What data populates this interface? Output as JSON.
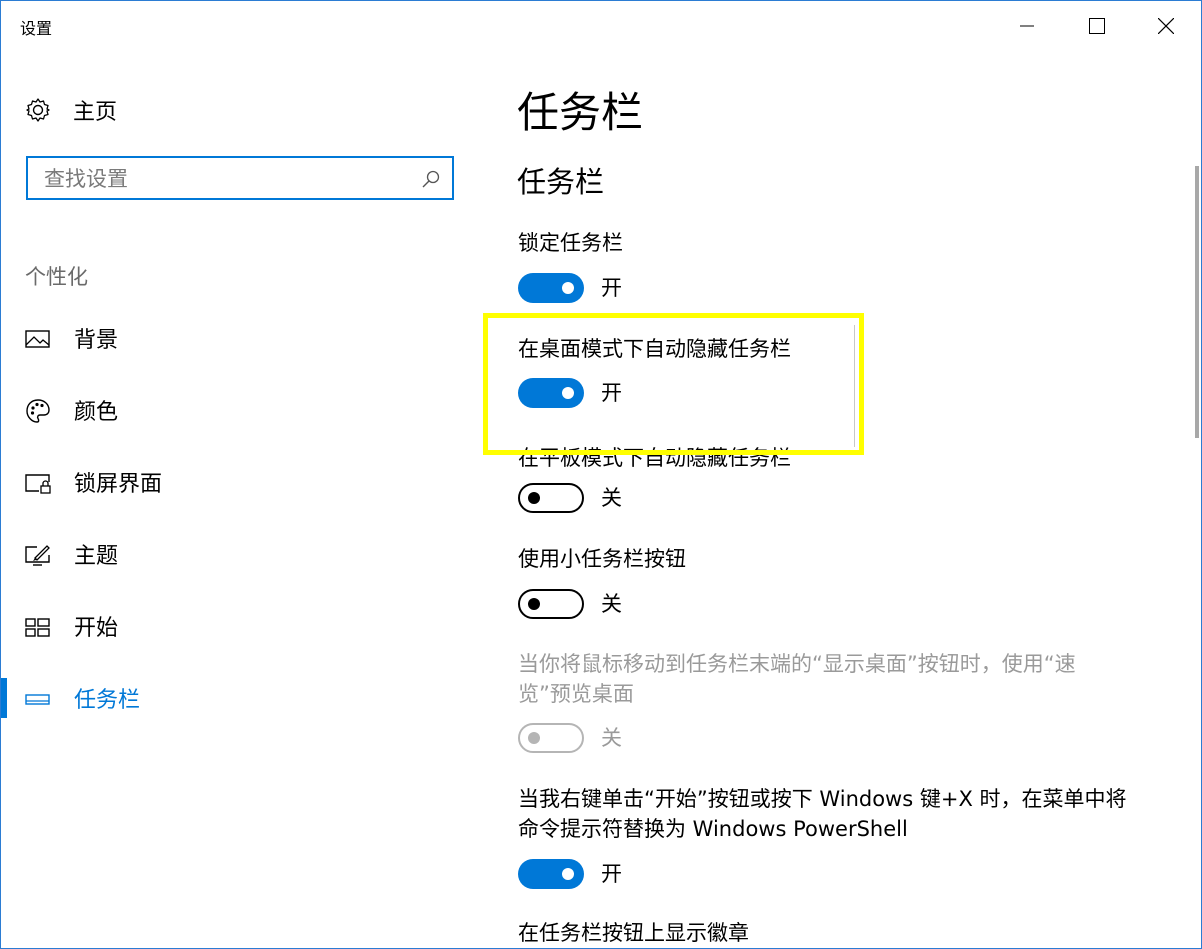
{
  "window": {
    "title": "设置"
  },
  "sidebar": {
    "home_label": "主页",
    "search_placeholder": "查找设置",
    "group_label": "个性化",
    "items": [
      {
        "label": "背景",
        "icon": "picture-icon"
      },
      {
        "label": "颜色",
        "icon": "palette-icon"
      },
      {
        "label": "锁屏界面",
        "icon": "lock-screen-icon"
      },
      {
        "label": "主题",
        "icon": "theme-brush-icon"
      },
      {
        "label": "开始",
        "icon": "start-grid-icon"
      },
      {
        "label": "任务栏",
        "icon": "taskbar-icon",
        "active": true
      }
    ]
  },
  "main": {
    "page_title": "任务栏",
    "section_title": "任务栏",
    "settings": [
      {
        "label": "锁定任务栏",
        "state": "开"
      },
      {
        "label": "在桌面模式下自动隐藏任务栏",
        "state": "开"
      },
      {
        "label": "在平板模式下自动隐藏任务栏",
        "state": "关"
      },
      {
        "label": "使用小任务栏按钮",
        "state": "关"
      },
      {
        "label_line1": "当你将鼠标移动到任务栏末端的“显示桌面”按钮时，使用“速",
        "label_line2": "览”预览桌面",
        "state": "关"
      },
      {
        "label_line1": "当我右键单击“开始”按钮或按下 Windows 键+X 时，在菜单中将",
        "label_line2": "命令提示符替换为 Windows PowerShell",
        "state": "开"
      },
      {
        "label": "在任务栏按钮上显示徽章"
      }
    ]
  },
  "colors": {
    "accent": "#0078d7",
    "highlight": "#ffff00",
    "disabled": "#9a9a9a"
  }
}
